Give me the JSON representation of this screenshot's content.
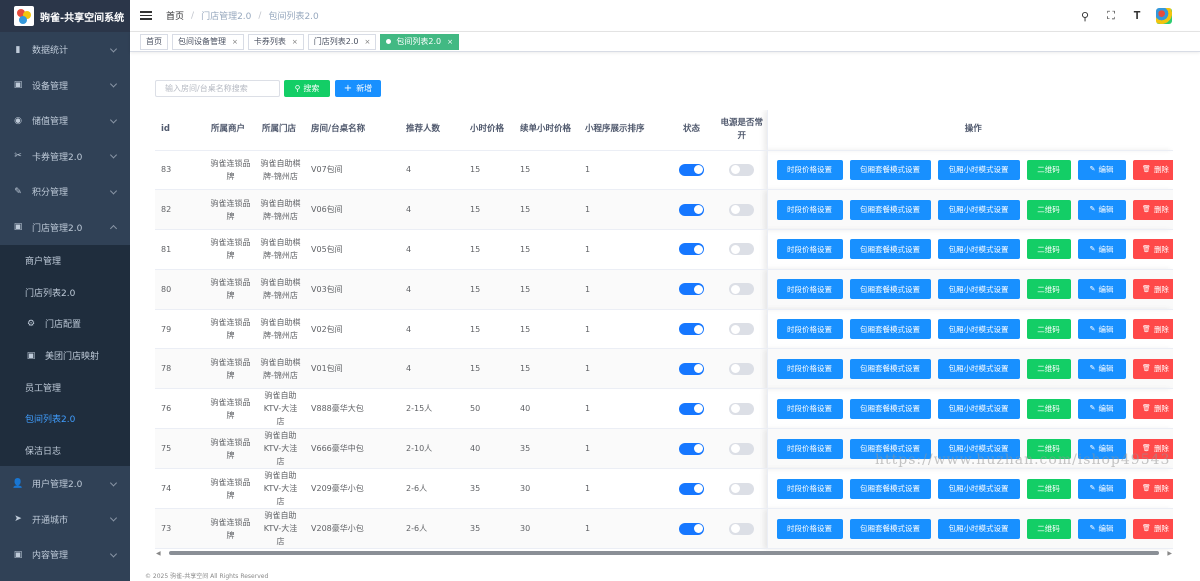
{
  "app": {
    "title": "驹雀-共享空间系统"
  },
  "sidebar": {
    "items": [
      {
        "label": "数据统计",
        "icon": "bar-chart-icon"
      },
      {
        "label": "设备管理",
        "icon": "calendar-icon"
      },
      {
        "label": "储值管理",
        "icon": "coin-icon"
      },
      {
        "label": "卡券管理2.0",
        "icon": "ticket-icon"
      },
      {
        "label": "积分管理",
        "icon": "edit-icon"
      },
      {
        "label": "门店管理2.0",
        "icon": "calendar-icon",
        "expanded": true
      }
    ],
    "submenu": [
      {
        "label": "商户管理"
      },
      {
        "label": "门店列表2.0"
      },
      {
        "label": "门店配置",
        "icon": "gear-icon"
      },
      {
        "label": "美团门店映射",
        "icon": "calendar-icon"
      },
      {
        "label": "员工管理"
      },
      {
        "label": "包间列表2.0",
        "active": true
      },
      {
        "label": "保洁日志"
      }
    ],
    "bottom": [
      {
        "label": "用户管理2.0",
        "icon": "users-icon"
      },
      {
        "label": "开通城市",
        "icon": "send-icon"
      },
      {
        "label": "内容管理",
        "icon": "calendar-icon"
      }
    ]
  },
  "header": {
    "breadcrumb": [
      "首页",
      "门店管理2.0",
      "包间列表2.0"
    ],
    "tools": [
      "search-icon",
      "fullscreen-icon",
      "font-size-icon"
    ]
  },
  "tags": [
    {
      "label": "首页",
      "closable": false
    },
    {
      "label": "包间设备管理",
      "closable": true
    },
    {
      "label": "卡券列表",
      "closable": true
    },
    {
      "label": "门店列表2.0",
      "closable": true
    },
    {
      "label": "包间列表2.0",
      "closable": true,
      "active": true
    }
  ],
  "search": {
    "placeholder": "输入房间/台桌名称搜索",
    "search_label": "搜索",
    "add_label": "新增"
  },
  "table": {
    "columns": [
      "id",
      "所属商户",
      "所属门店",
      "房间/台桌名称",
      "推荐人数",
      "小时价格",
      "续单小时价格",
      "小程序展示排序",
      "状态",
      "电源是否常开",
      "操作"
    ],
    "actions": [
      "时段价格设置",
      "包厢套餐模式设置",
      "包厢小时模式设置",
      "二维码",
      "编辑",
      "删除"
    ],
    "rows": [
      {
        "id": "83",
        "merchant": "驹雀连锁品牌",
        "store": "驹雀自助棋牌-锦州店",
        "name": "V07包间",
        "people": "4",
        "price": "15",
        "renew": "15",
        "sort": "1",
        "status": true,
        "power": false
      },
      {
        "id": "82",
        "merchant": "驹雀连锁品牌",
        "store": "驹雀自助棋牌-锦州店",
        "name": "V06包间",
        "people": "4",
        "price": "15",
        "renew": "15",
        "sort": "1",
        "status": true,
        "power": false
      },
      {
        "id": "81",
        "merchant": "驹雀连锁品牌",
        "store": "驹雀自助棋牌-锦州店",
        "name": "V05包间",
        "people": "4",
        "price": "15",
        "renew": "15",
        "sort": "1",
        "status": true,
        "power": false
      },
      {
        "id": "80",
        "merchant": "驹雀连锁品牌",
        "store": "驹雀自助棋牌-锦州店",
        "name": "V03包间",
        "people": "4",
        "price": "15",
        "renew": "15",
        "sort": "1",
        "status": true,
        "power": false
      },
      {
        "id": "79",
        "merchant": "驹雀连锁品牌",
        "store": "驹雀自助棋牌-锦州店",
        "name": "V02包间",
        "people": "4",
        "price": "15",
        "renew": "15",
        "sort": "1",
        "status": true,
        "power": false
      },
      {
        "id": "78",
        "merchant": "驹雀连锁品牌",
        "store": "驹雀自助棋牌-锦州店",
        "name": "V01包间",
        "people": "4",
        "price": "15",
        "renew": "15",
        "sort": "1",
        "status": true,
        "power": false
      },
      {
        "id": "76",
        "merchant": "驹雀连锁品牌",
        "store": "驹雀自助KTV-大洼店",
        "name": "V888豪华大包",
        "people": "2-15人",
        "price": "50",
        "renew": "40",
        "sort": "1",
        "status": true,
        "power": false
      },
      {
        "id": "75",
        "merchant": "驹雀连锁品牌",
        "store": "驹雀自助KTV-大洼店",
        "name": "V666豪华中包",
        "people": "2-10人",
        "price": "40",
        "renew": "35",
        "sort": "1",
        "status": true,
        "power": false
      },
      {
        "id": "74",
        "merchant": "驹雀连锁品牌",
        "store": "驹雀自助KTV-大洼店",
        "name": "V209豪华小包",
        "people": "2-6人",
        "price": "35",
        "renew": "30",
        "sort": "1",
        "status": true,
        "power": false
      },
      {
        "id": "73",
        "merchant": "驹雀连锁品牌",
        "store": "驹雀自助KTV-大洼店",
        "name": "V208豪华小包",
        "people": "2-6人",
        "price": "35",
        "renew": "30",
        "sort": "1",
        "status": true,
        "power": false
      }
    ]
  },
  "footer": "© 2025 驹雀-共享空间 All Rights Reserved",
  "watermark": "https://www.huzhan.com/ishop49543"
}
